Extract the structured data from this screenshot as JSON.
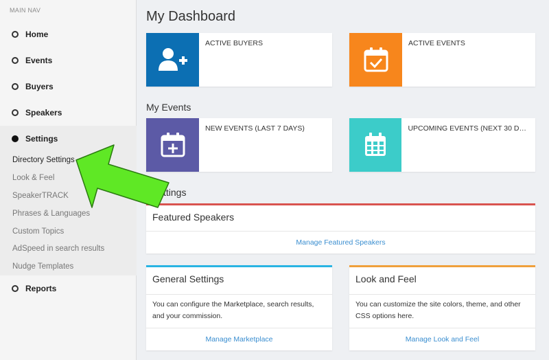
{
  "sidebar": {
    "header": "MAIN NAV",
    "items": [
      {
        "label": "Home"
      },
      {
        "label": "Events"
      },
      {
        "label": "Buyers"
      },
      {
        "label": "Speakers"
      },
      {
        "label": "Settings"
      },
      {
        "label": "Reports"
      }
    ],
    "settings_sub": [
      "Directory Settings",
      "Look & Feel",
      "SpeakerTRACK",
      "Phrases & Languages",
      "Custom Topics",
      "AdSpeed in search results",
      "Nudge Templates"
    ]
  },
  "main": {
    "title": "My Dashboard",
    "stats": [
      {
        "label": "ACTIVE BUYERS",
        "icon": "add-user-icon",
        "color": "#0c6fb3"
      },
      {
        "label": "ACTIVE EVENTS",
        "icon": "calendar-check-icon",
        "color": "#f7861c"
      }
    ],
    "events_title": "My Events",
    "events": [
      {
        "label": "NEW EVENTS (LAST 7 DAYS)",
        "icon": "calendar-plus-icon",
        "color": "#5c5aa6"
      },
      {
        "label": "UPCOMING EVENTS (NEXT 30 DA...",
        "icon": "calendar-grid-icon",
        "color": "#3cccc9"
      }
    ],
    "settings_title": "ttings",
    "featured": {
      "title": "Featured Speakers",
      "link": "Manage Featured Speakers",
      "accent": "#d9534f"
    },
    "general": {
      "title": "General Settings",
      "desc": "You can configure the Marketplace, search results, and your commission.",
      "link": "Manage Marketplace",
      "accent": "#29b4e3"
    },
    "look": {
      "title": "Look and Feel",
      "desc": "You can customize the site colors, theme, and other CSS options here.",
      "link": "Manage Look and Feel",
      "accent": "#f0a03c"
    }
  },
  "annotation": {
    "arrow_color": "#5fe825"
  }
}
